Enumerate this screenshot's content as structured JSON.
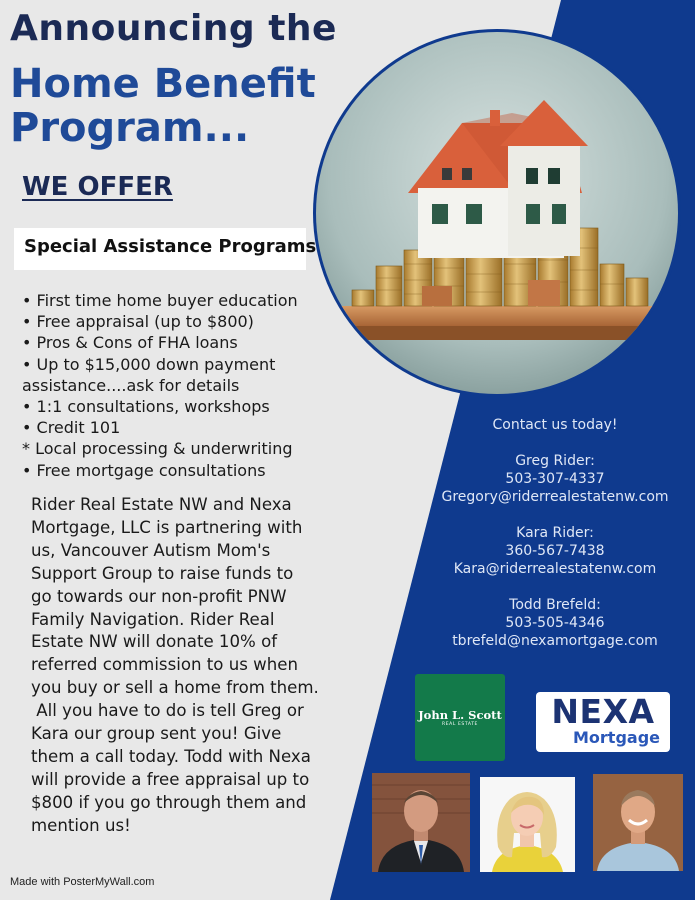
{
  "header": {
    "title_line1": "Announcing the",
    "title_line2": "Home Benefit",
    "title_line3": "Program..."
  },
  "offer_heading": "WE OFFER",
  "section_title": "Special Assistance Programs",
  "bullets": [
    "• First time home buyer education",
    "• Free appraisal (up to $800)",
    "• Pros & Cons of FHA loans",
    "• Up to $15,000 down payment",
    "assistance....ask for details",
    "• 1:1 consultations, workshops",
    "• Credit 101",
    "* Local processing & underwriting",
    "• Free mortgage consultations"
  ],
  "story_lines": [
    "Rider Real Estate NW and Nexa",
    "Mortgage, LLC is partnering with",
    "us, Vancouver Autism Mom's",
    "Support Group to raise funds to",
    "go towards our non-profit PNW",
    "Family Navigation.  Rider Real",
    "Estate NW will donate 10% of",
    "referred commission to us when",
    "you buy or sell a home from them.",
    " All you have to do is tell Greg or",
    "Kara our group sent you!  Give",
    "them a call today.  Todd with Nexa",
    "will provide a free appraisal up to",
    "$800 if you go through them and",
    "mention us!"
  ],
  "contact": {
    "heading": "Contact us today!",
    "people": [
      {
        "name": "Greg Rider:",
        "phone": "503-307-4337",
        "email": "Gregory@riderrealestatenw.com"
      },
      {
        "name": "Kara Rider:",
        "phone": "360-567-7438",
        "email": "Kara@riderrealestatenw.com"
      },
      {
        "name": "Todd Brefeld:",
        "phone": "503-505-4346",
        "email": "tbrefeld@nexamortgage.com"
      }
    ]
  },
  "logos": {
    "john_l_scott": {
      "name": "John L. Scott",
      "sub": "REAL ESTATE"
    },
    "nexa": {
      "name": "NEXA",
      "sub": "Mortgage"
    }
  },
  "footer": "Made with PosterMyWall.com",
  "colors": {
    "navy": "#1b2a55",
    "blue_title": "#1f4a98",
    "panel_blue": "#0f3a8e",
    "left_bg": "#e8e8e8",
    "jls_green": "#137a4a"
  },
  "images": {
    "hero": "house-on-coin-stacks",
    "photo_1": "man-in-suit-portrait",
    "photo_2": "blonde-woman-portrait",
    "photo_3": "smiling-man-portrait"
  }
}
